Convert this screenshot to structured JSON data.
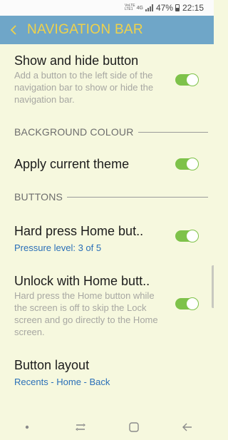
{
  "status": {
    "volte": "VoLTE",
    "lte": "LTE1",
    "network": "4G",
    "battery": "47%",
    "time": "22:15"
  },
  "header": {
    "title": "NAVIGATION BAR"
  },
  "settings": [
    {
      "title": "Show and hide button",
      "description": "Add a button to the left side of the navigation bar to show or hide the navigation bar.",
      "toggle": true
    },
    {
      "title": "Apply current theme",
      "toggle": true
    },
    {
      "title": "Hard press Home but..",
      "subtitle": "Pressure level: 3 of 5",
      "toggle": true
    },
    {
      "title": "Unlock with Home butt..",
      "description": "Hard press the Home button while the screen is off to skip the Lock screen and go directly to the Home screen.",
      "toggle": true
    },
    {
      "title": "Button layout",
      "subtitle": "Recents - Home - Back"
    }
  ],
  "sections": {
    "background": "BACKGROUND COLOUR",
    "buttons": "BUTTONS"
  },
  "colors": {
    "title_bar": "#6fa6c8",
    "title_text": "#f0d24a",
    "background": "#f6f8de",
    "toggle_on": "#7ec24a",
    "link": "#2a6fb8"
  }
}
